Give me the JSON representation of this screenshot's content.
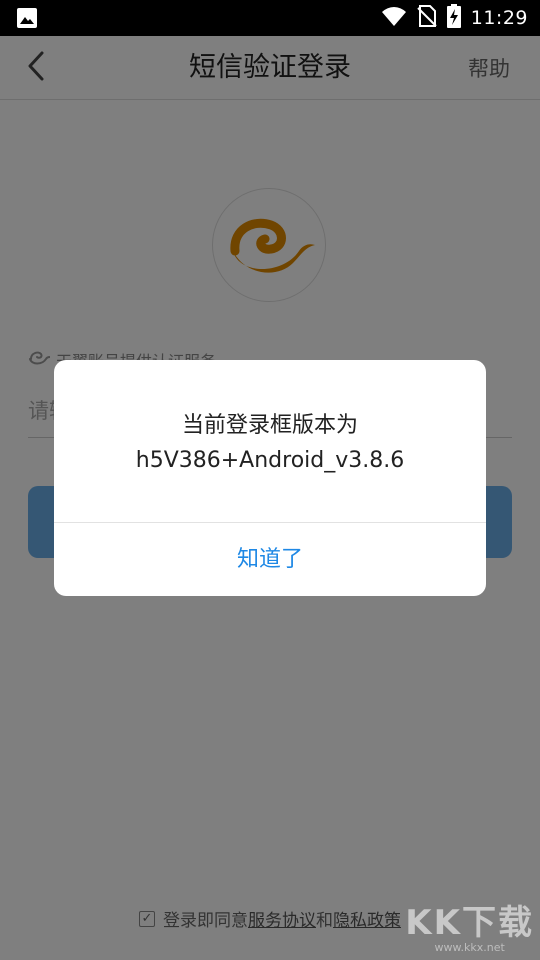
{
  "status_bar": {
    "time": "11:29",
    "icons": [
      "image-icon",
      "wifi-icon",
      "no-sim-icon",
      "battery-charging-icon"
    ]
  },
  "app_bar": {
    "back_icon": "chevron-left-icon",
    "title": "短信验证登录",
    "help_label": "帮助"
  },
  "content": {
    "logo": "china-telecom-logo",
    "tianyi_label": "天翼账号提供认证服务",
    "phone_placeholder": "请输入手机号",
    "login_button_label": "",
    "agreement": {
      "checked": true,
      "prefix": "登录即同意",
      "service_link": "服务协议",
      "conjunction": "和",
      "privacy_link": "隐私政策"
    }
  },
  "dialog": {
    "line1": "当前登录框版本为",
    "line2": "h5V386+Android_v3.8.6",
    "confirm_label": "知道了"
  },
  "watermark": {
    "big": "KK下载",
    "small": "www.kkx.net"
  },
  "colors": {
    "accent": "#1e88e5",
    "logo_orange": "#e08a00",
    "login_button": "#6aaee8",
    "overlay": "rgba(0,0,0,0.5)"
  }
}
